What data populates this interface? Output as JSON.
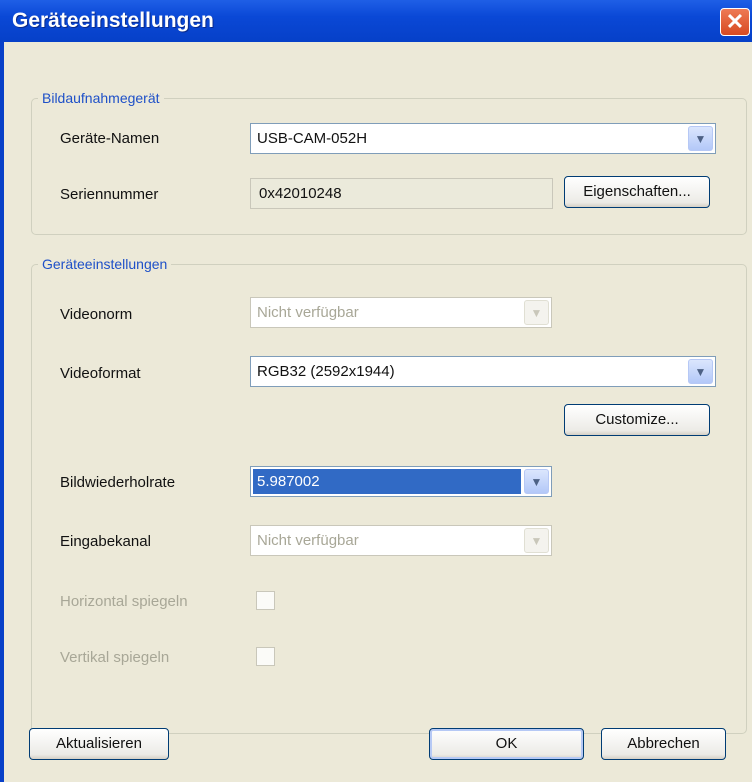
{
  "window": {
    "title": "Geräteeinstellungen",
    "close_glyph": "✕"
  },
  "capture_group": {
    "legend": "Bildaufnahmegerät",
    "device_name_label": "Geräte-Namen",
    "device_name_value": "USB-CAM-052H",
    "serial_label": "Seriennummer",
    "serial_value": "0x42010248",
    "properties_button": "Eigenschaften..."
  },
  "settings_group": {
    "legend": "Geräteeinstellungen",
    "videonorm_label": "Videonorm",
    "videonorm_value": "Nicht verfügbar",
    "videoformat_label": "Videoformat",
    "videoformat_value": "RGB32 (2592x1944)",
    "customize_button": "Customize...",
    "framerate_label": "Bildwiederholrate",
    "framerate_value": "5.987002",
    "input_label": "Eingabekanal",
    "input_value": "Nicht verfügbar",
    "flip_h_label": "Horizontal spiegeln",
    "flip_v_label": "Vertikal spiegeln"
  },
  "footer": {
    "refresh_button": "Aktualisieren",
    "ok_button": "OK",
    "cancel_button": "Abbrechen"
  },
  "icons": {
    "dropdown": "▼"
  }
}
